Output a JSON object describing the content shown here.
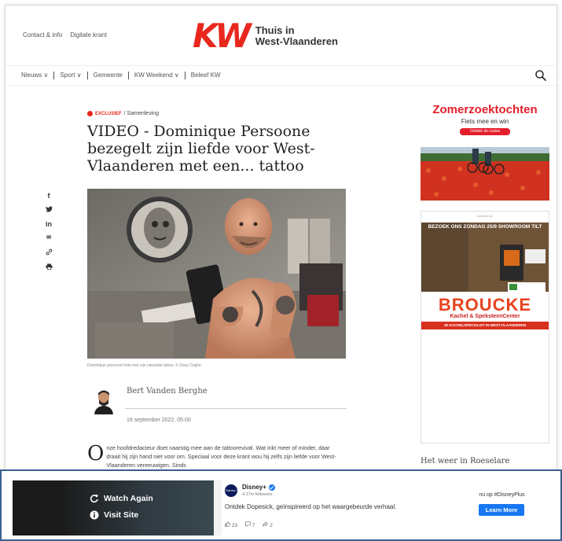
{
  "header": {
    "top_links": [
      "Contact & info",
      "Digitale krant"
    ],
    "logo_mark": "KW",
    "logo_line1": "Thuis in",
    "logo_line2": "West-Vlaanderen"
  },
  "nav": {
    "items": [
      "Nieuws ∨",
      "Sport ∨",
      "Gemeente",
      "KW Weekend ∨",
      "Beleef KW"
    ]
  },
  "article": {
    "category_tag": "Exclusief",
    "category": "/ Samenleving",
    "headline": "VIDEO - Dominique Persoone bezegelt zijn liefde voor West-Vlaanderen met een... tattoo",
    "photo_caption": "Dominique persoont trots met zijn nieuwste tattoo. © Davy Coghe",
    "author": "Bert Vanden Berghe",
    "date": "16 september 2022, 05:00",
    "dropcap": "O",
    "body": "nze hoofdredacteur doet naarstig mee aan de tattoorevival. Wat inkt meer of minder, daar draait hij zijn hand niet voor om. Speciaal voor deze krant wou hij zelfs zijn liefde voor West-Vlaanderen vereeuwigen. Sinds"
  },
  "share_icons": [
    "f",
    "t",
    "in",
    "✉",
    "🔗",
    "🖶"
  ],
  "ads": {
    "ad1_title": "Zomerzoektochten",
    "ad1_sub": "Fiets mee en win",
    "ad1_button": "Ontdek de routes",
    "ad2_label": "advertentie",
    "ad2_top": "BEZOEK ONS ZONDAG 25/9 SHOWROOM TILT",
    "ad2_brand": "BROUCKE",
    "ad2_brand_sub": "Kachel & SpeksteenCenter",
    "ad2_bar": "JE KACHELSPECIALIST IN WEST-VLAANDEREN"
  },
  "weather_title": "Het weer in Roeselare",
  "video_bar": {
    "watch_again": "Watch Again",
    "visit_site": "Visit Site",
    "page_name": "Disney+",
    "followers": "4.17m followers",
    "post_text": "Ontdek Dopesick, geïnspireerd op het waargebeurde verhaal.",
    "likes": "23",
    "comments": "7",
    "shares": "2",
    "cta_label": "nu op #DisneyPlus",
    "cta_button": "Learn More",
    "avatar_text": "Disney+"
  },
  "colors": {
    "brand_red": "#e8281e",
    "fb_blue": "#1877f2",
    "bar_border": "#3a5f8f"
  }
}
